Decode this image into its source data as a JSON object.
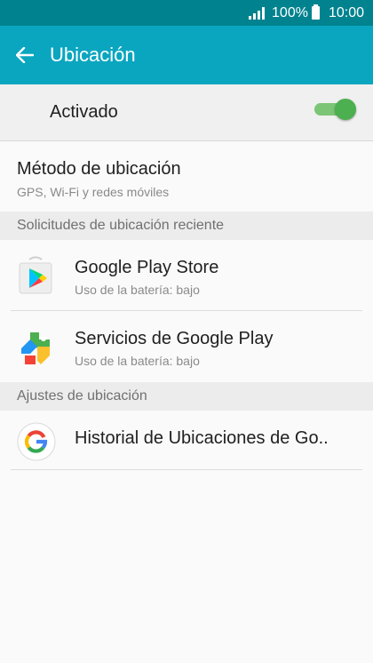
{
  "status_bar": {
    "battery": "100%",
    "time": "10:00"
  },
  "header": {
    "title": "Ubicación"
  },
  "master_toggle": {
    "label": "Activado",
    "state": "on"
  },
  "location_method": {
    "title": "Método de ubicación",
    "subtitle": "GPS, Wi-Fi y redes móviles"
  },
  "recent_requests": {
    "header": "Solicitudes de ubicación reciente",
    "items": [
      {
        "name": "Google Play Store",
        "detail": "Uso de la batería: bajo",
        "icon": "google-play-store-icon"
      },
      {
        "name": "Servicios de Google Play",
        "detail": "Uso de la batería: bajo",
        "icon": "google-play-services-icon"
      }
    ]
  },
  "location_settings": {
    "header": "Ajustes de ubicación",
    "items": [
      {
        "name": "Historial de Ubicaciones de Go..",
        "icon": "google-icon"
      }
    ]
  },
  "colors": {
    "status_bar": "#00838f",
    "app_bar": "#0aa6c0",
    "toggle_on": "#4caf50"
  }
}
